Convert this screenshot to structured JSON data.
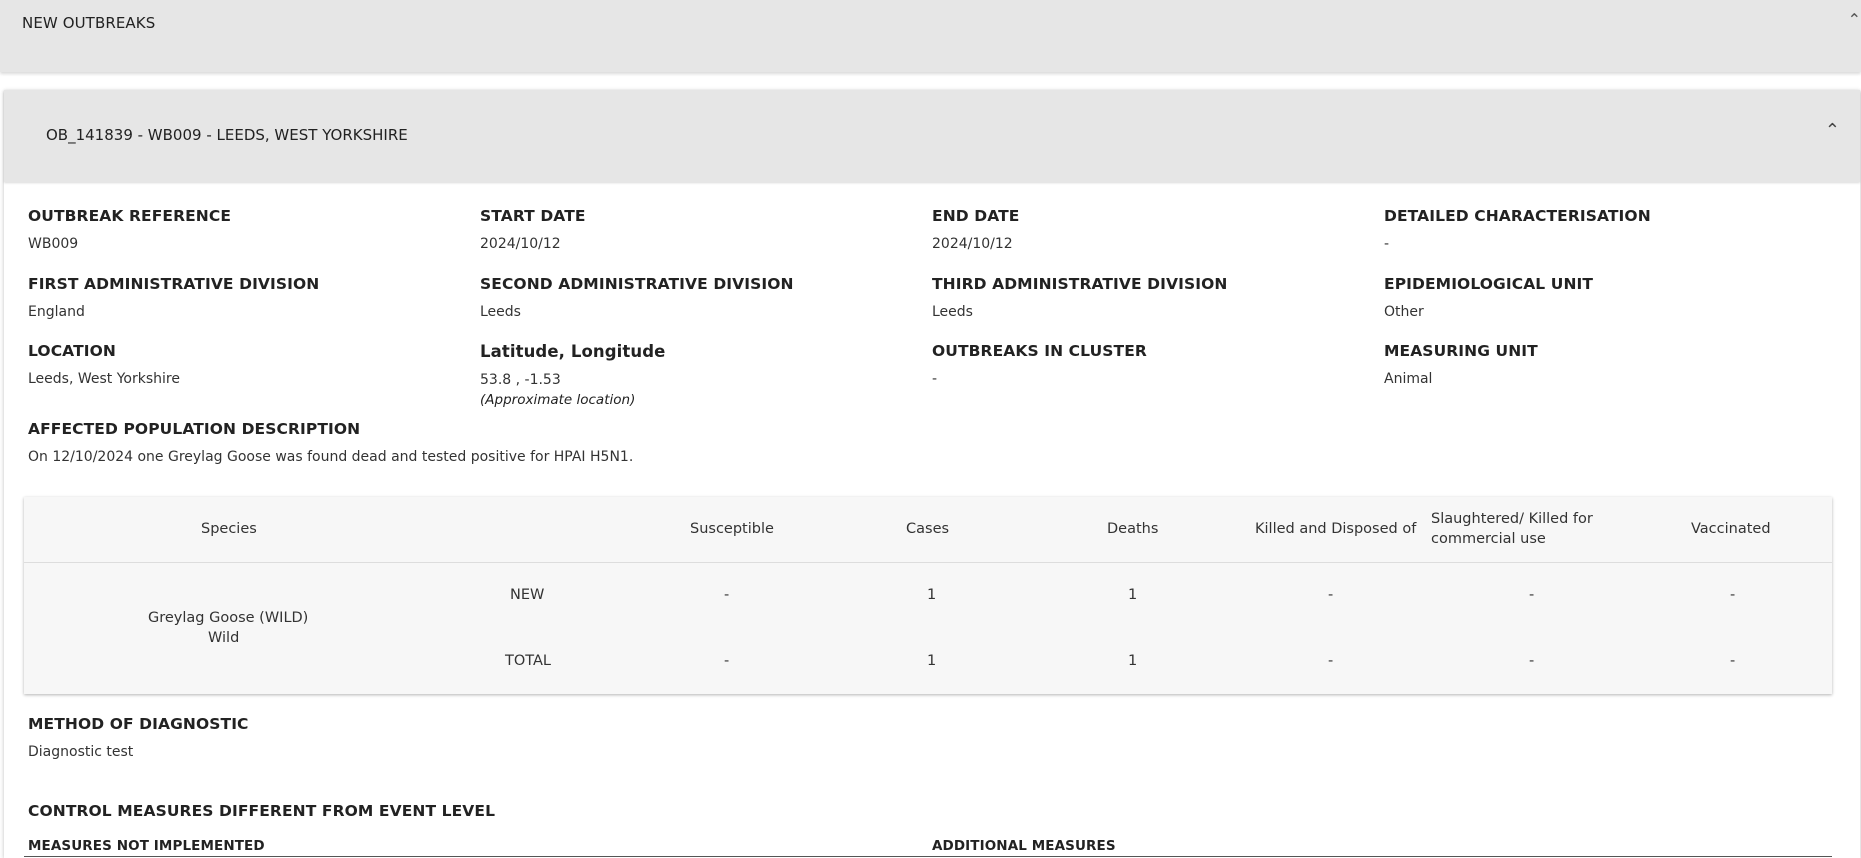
{
  "top_panel": {
    "title": "NEW OUTBREAKS",
    "chevron_icon": "chevron-up-icon"
  },
  "outbreak": {
    "header_title": "OB_141839 - WB009 - LEEDS, WEST YORKSHIRE",
    "chevron_icon": "chevron-up-icon",
    "fields": {
      "reference": {
        "label": "OUTBREAK REFERENCE",
        "value": "WB009"
      },
      "start_date": {
        "label": "START DATE",
        "value": "2024/10/12"
      },
      "end_date": {
        "label": "END DATE",
        "value": "2024/10/12"
      },
      "detailed_characterisation": {
        "label": "DETAILED CHARACTERISATION",
        "value": "-"
      },
      "first_admin": {
        "label": "FIRST ADMINISTRATIVE DIVISION",
        "value": "England"
      },
      "second_admin": {
        "label": "SECOND ADMINISTRATIVE DIVISION",
        "value": "Leeds"
      },
      "third_admin": {
        "label": "THIRD ADMINISTRATIVE DIVISION",
        "value": "Leeds"
      },
      "epi_unit": {
        "label": "EPIDEMIOLOGICAL UNIT",
        "value": "Other"
      },
      "location": {
        "label": "LOCATION",
        "value": "Leeds, West Yorkshire"
      },
      "latlon": {
        "label": "Latitude, Longitude",
        "value": "53.8 , -1.53",
        "note": "(Approximate location)"
      },
      "cluster": {
        "label": "OUTBREAKS IN CLUSTER",
        "value": "-"
      },
      "measuring_unit": {
        "label": "MEASURING UNIT",
        "value": "Animal"
      },
      "population": {
        "label": "AFFECTED POPULATION DESCRIPTION",
        "value": "On 12/10/2024 one Greylag Goose was found dead and tested positive for HPAI H5N1."
      },
      "diagnostic": {
        "label": "METHOD OF DIAGNOSTIC",
        "value": "Diagnostic test"
      }
    },
    "table": {
      "headers": {
        "species": "Species",
        "susceptible": "Susceptible",
        "cases": "Cases",
        "deaths": "Deaths",
        "killed": "Killed and Disposed of",
        "slaughtered_1": "Slaughtered/ Killed for",
        "slaughtered_2": "commercial use",
        "vaccinated": "Vaccinated"
      },
      "species_name": "Greylag Goose (WILD)",
      "species_type": "Wild",
      "rows": [
        {
          "label": "NEW",
          "susceptible": "-",
          "cases": "1",
          "deaths": "1",
          "killed": "-",
          "slaughtered": "-",
          "vaccinated": "-"
        },
        {
          "label": "TOTAL",
          "susceptible": "-",
          "cases": "1",
          "deaths": "1",
          "killed": "-",
          "slaughtered": "-",
          "vaccinated": "-"
        }
      ]
    },
    "control_measures": {
      "title": "CONTROL MEASURES DIFFERENT FROM EVENT LEVEL",
      "not_implemented_label": "MEASURES NOT IMPLEMENTED",
      "additional_label": "ADDITIONAL MEASURES"
    }
  }
}
